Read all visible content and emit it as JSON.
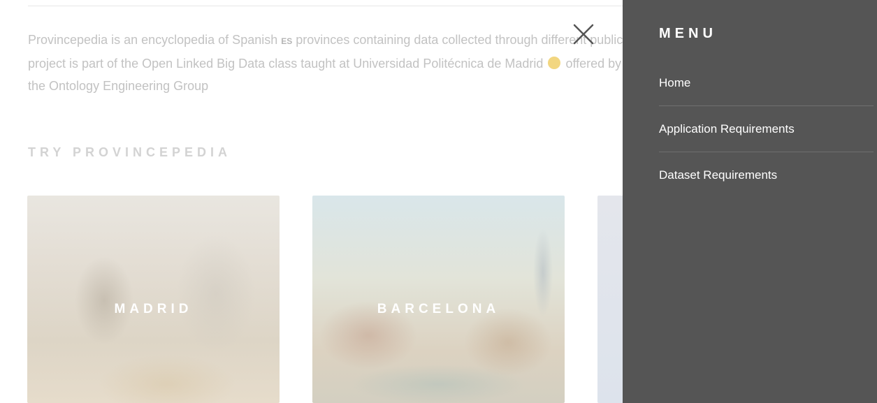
{
  "intro": {
    "line1_a": "Provincepedia is an encyclopedia of Spanish",
    "flag_code": "ES",
    "line1_b": "provinces containing data collected through different public CSV d",
    "line2_a": "project is part of the Open Linked Big Data class taught at Universidad Politécnica de Madrid",
    "line2_b": "offered by prof. R",
    "line3": "the Ontology Engineering Group"
  },
  "section": {
    "title": "TRY PROVINCEPEDIA"
  },
  "cards": [
    {
      "label": "MADRID"
    },
    {
      "label": "BARCELONA"
    },
    {
      "label": ""
    }
  ],
  "menu": {
    "title": "MENU",
    "items": [
      {
        "label": "Home"
      },
      {
        "label": "Application Requirements"
      },
      {
        "label": "Dataset Requirements"
      }
    ]
  },
  "icons": {
    "close": "close-icon",
    "sun": "sun-emoji-icon"
  },
  "colors": {
    "menu_background": "#555555",
    "faded_text": "#c2c2c2",
    "menu_text": "#ffffff"
  }
}
